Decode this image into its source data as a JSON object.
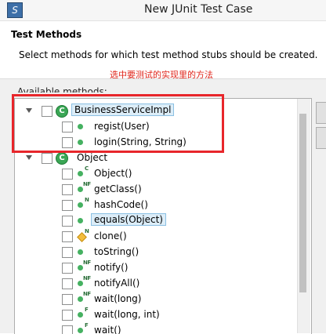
{
  "window": {
    "title": "New JUnit Test Case",
    "icon": "eclipse-icon"
  },
  "header": {
    "title": "Test Methods",
    "description": "Select methods for which test method stubs should be created."
  },
  "annotation": "选中要测试的实现里的方法",
  "available_label": "Available methods:",
  "tree": [
    {
      "label": "BusinessServiceImpl",
      "kind": "class",
      "icon": "class-icon",
      "badge": "",
      "selected": true,
      "checked": false
    },
    {
      "label": "regist(User)",
      "kind": "public-method",
      "icon": "public-method-icon",
      "badge": "",
      "selected": false,
      "checked": false
    },
    {
      "label": "login(String, String)",
      "kind": "public-method",
      "icon": "public-method-icon",
      "badge": "",
      "selected": false,
      "checked": false
    },
    {
      "label": "Object",
      "kind": "class",
      "icon": "class-icon",
      "badge": "",
      "selected": false,
      "checked": false
    },
    {
      "label": "Object()",
      "kind": "constructor",
      "icon": "public-method-icon",
      "badge": "C",
      "selected": false,
      "checked": false
    },
    {
      "label": "getClass()",
      "kind": "public-method",
      "icon": "public-method-icon",
      "badge": "NF",
      "selected": false,
      "checked": false
    },
    {
      "label": "hashCode()",
      "kind": "public-method",
      "icon": "public-method-icon",
      "badge": "N",
      "selected": false,
      "checked": false
    },
    {
      "label": "equals(Object)",
      "kind": "public-method",
      "icon": "public-method-icon",
      "badge": "",
      "selected": true,
      "checked": false
    },
    {
      "label": "clone()",
      "kind": "protected-method",
      "icon": "protected-method-icon",
      "badge": "N",
      "selected": false,
      "checked": false
    },
    {
      "label": "toString()",
      "kind": "public-method",
      "icon": "public-method-icon",
      "badge": "",
      "selected": false,
      "checked": false
    },
    {
      "label": "notify()",
      "kind": "public-method",
      "icon": "public-method-icon",
      "badge": "NF",
      "selected": false,
      "checked": false
    },
    {
      "label": "notifyAll()",
      "kind": "public-method",
      "icon": "public-method-icon",
      "badge": "NF",
      "selected": false,
      "checked": false
    },
    {
      "label": "wait(long)",
      "kind": "public-method",
      "icon": "public-method-icon",
      "badge": "NF",
      "selected": false,
      "checked": false
    },
    {
      "label": "wait(long, int)",
      "kind": "public-method",
      "icon": "public-method-icon",
      "badge": "F",
      "selected": false,
      "checked": false
    },
    {
      "label": "wait()",
      "kind": "public-method",
      "icon": "public-method-icon",
      "badge": "F",
      "selected": false,
      "checked": false
    }
  ],
  "colors": {
    "annotation_red": "#e8262b",
    "selection_bg": "#dcedf8",
    "method_green": "#45b161"
  }
}
